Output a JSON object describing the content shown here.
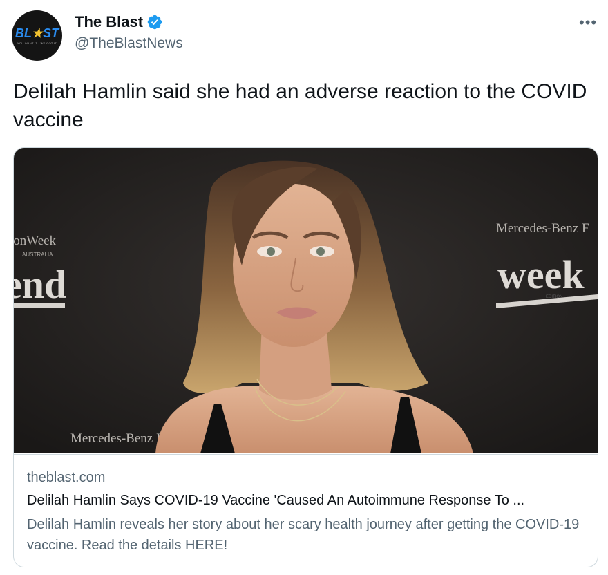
{
  "author": {
    "name": "The Blast",
    "handle": "@TheBlastNews",
    "avatar_logo_prefix": "BL",
    "avatar_logo_star": "★",
    "avatar_logo_suffix": "ST",
    "avatar_tagline": "YOU WANT IT · WE GOT IT",
    "verified": true
  },
  "more_icon": "•••",
  "tweet": {
    "text": "Delilah Hamlin said she had an adverse reaction to the COVID vaccine"
  },
  "card": {
    "image_backdrop_texts": [
      "ionWeek",
      "AUSTRALIA",
      "end",
      "Mercedes-Benz F",
      "week",
      "EDITION",
      "Mercedes-Benz I"
    ],
    "domain": "theblast.com",
    "title": "Delilah Hamlin Says COVID-19 Vaccine 'Caused An Autoimmune Response To ...",
    "description": "Delilah Hamlin reveals her story about her scary health journey after getting the COVID-19 vaccine. Read the details HERE!"
  },
  "colors": {
    "accent": "#1d9bf0",
    "text_primary": "#0f1419",
    "text_secondary": "#536471",
    "border": "#cfd9de"
  }
}
